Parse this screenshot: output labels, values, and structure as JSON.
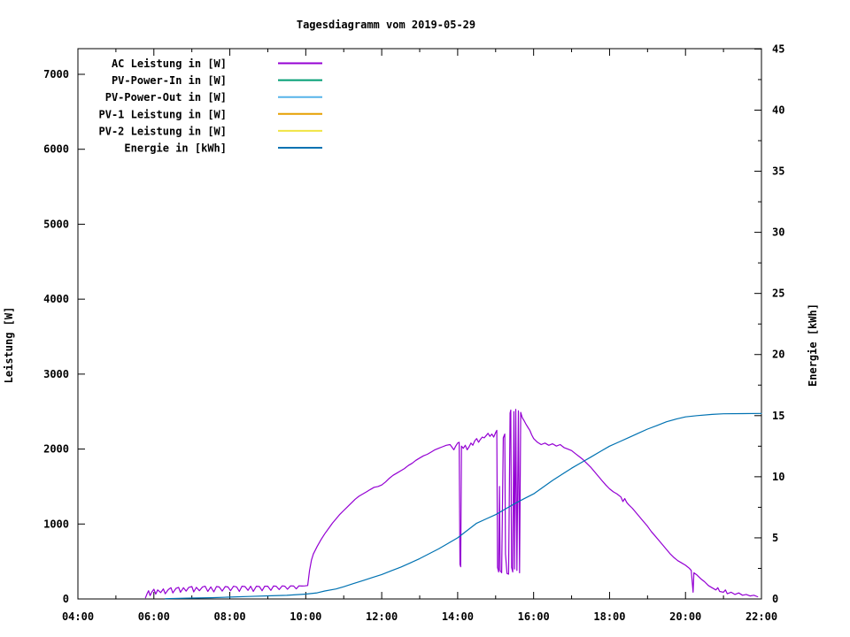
{
  "page": {
    "background": "#ffffff"
  },
  "chart_data": {
    "type": "line",
    "title": "Tagesdiagramm vom 2019-05-29",
    "grid": false,
    "legend_position": "top-left-inside",
    "x_axis": {
      "unit": "time-of-day",
      "start_hour": 4,
      "end_hour": 22,
      "major_tick_hours": 2,
      "minor_tick_hours": 1,
      "tick_labels": [
        "04:00",
        "06:00",
        "08:00",
        "10:00",
        "12:00",
        "14:00",
        "16:00",
        "18:00",
        "20:00",
        "22:00"
      ]
    },
    "y_axis": {
      "label": "Leistung [W]",
      "min": 0,
      "max": 7345,
      "tick_step": 1000,
      "tick_labels": [
        "0",
        "1000",
        "2000",
        "3000",
        "4000",
        "5000",
        "6000",
        "7000"
      ]
    },
    "y2_axis": {
      "label": "Energie [kWh]",
      "min": 0,
      "max": 45,
      "tick_step": 5,
      "minor_tick_step": 2.5,
      "tick_labels": [
        "0",
        "5",
        "10",
        "15",
        "20",
        "25",
        "30",
        "35",
        "40",
        "45"
      ]
    },
    "series": [
      {
        "name": "AC Leistung in [W]",
        "slug": "ac-leistung",
        "color": "#9400d3",
        "axis": "y1",
        "points": [
          [
            5.78,
            15
          ],
          [
            5.82,
            70
          ],
          [
            5.86,
            110
          ],
          [
            5.9,
            45
          ],
          [
            5.95,
            95
          ],
          [
            6.0,
            130
          ],
          [
            6.05,
            65
          ],
          [
            6.1,
            120
          ],
          [
            6.18,
            85
          ],
          [
            6.25,
            135
          ],
          [
            6.3,
            70
          ],
          [
            6.38,
            125
          ],
          [
            6.45,
            150
          ],
          [
            6.5,
            80
          ],
          [
            6.58,
            140
          ],
          [
            6.65,
            155
          ],
          [
            6.7,
            90
          ],
          [
            6.78,
            150
          ],
          [
            6.85,
            105
          ],
          [
            6.92,
            155
          ],
          [
            7.0,
            165
          ],
          [
            7.05,
            95
          ],
          [
            7.12,
            155
          ],
          [
            7.2,
            110
          ],
          [
            7.28,
            160
          ],
          [
            7.35,
            170
          ],
          [
            7.42,
            100
          ],
          [
            7.5,
            160
          ],
          [
            7.58,
            95
          ],
          [
            7.65,
            165
          ],
          [
            7.72,
            160
          ],
          [
            7.8,
            105
          ],
          [
            7.88,
            165
          ],
          [
            7.95,
            160
          ],
          [
            8.02,
            110
          ],
          [
            8.1,
            170
          ],
          [
            8.18,
            160
          ],
          [
            8.25,
            100
          ],
          [
            8.32,
            170
          ],
          [
            8.4,
            165
          ],
          [
            8.48,
            115
          ],
          [
            8.55,
            170
          ],
          [
            8.62,
            100
          ],
          [
            8.7,
            170
          ],
          [
            8.78,
            165
          ],
          [
            8.85,
            110
          ],
          [
            8.92,
            170
          ],
          [
            9.0,
            170
          ],
          [
            9.08,
            115
          ],
          [
            9.15,
            172
          ],
          [
            9.22,
            170
          ],
          [
            9.3,
            125
          ],
          [
            9.38,
            175
          ],
          [
            9.45,
            170
          ],
          [
            9.52,
            130
          ],
          [
            9.6,
            175
          ],
          [
            9.68,
            172
          ],
          [
            9.75,
            135
          ],
          [
            9.82,
            175
          ],
          [
            9.9,
            172
          ],
          [
            9.98,
            175
          ],
          [
            10.05,
            180
          ],
          [
            10.1,
            380
          ],
          [
            10.15,
            520
          ],
          [
            10.2,
            600
          ],
          [
            10.3,
            700
          ],
          [
            10.4,
            790
          ],
          [
            10.5,
            870
          ],
          [
            10.6,
            940
          ],
          [
            10.7,
            1010
          ],
          [
            10.8,
            1070
          ],
          [
            10.9,
            1130
          ],
          [
            11.0,
            1180
          ],
          [
            11.1,
            1230
          ],
          [
            11.2,
            1280
          ],
          [
            11.3,
            1330
          ],
          [
            11.4,
            1370
          ],
          [
            11.5,
            1400
          ],
          [
            11.6,
            1430
          ],
          [
            11.7,
            1460
          ],
          [
            11.8,
            1490
          ],
          [
            11.9,
            1500
          ],
          [
            12.0,
            1520
          ],
          [
            12.1,
            1560
          ],
          [
            12.2,
            1610
          ],
          [
            12.3,
            1650
          ],
          [
            12.4,
            1680
          ],
          [
            12.5,
            1710
          ],
          [
            12.6,
            1740
          ],
          [
            12.7,
            1780
          ],
          [
            12.8,
            1810
          ],
          [
            12.9,
            1850
          ],
          [
            13.0,
            1880
          ],
          [
            13.1,
            1910
          ],
          [
            13.2,
            1930
          ],
          [
            13.3,
            1960
          ],
          [
            13.4,
            1990
          ],
          [
            13.5,
            2010
          ],
          [
            13.6,
            2030
          ],
          [
            13.7,
            2050
          ],
          [
            13.8,
            2060
          ],
          [
            13.9,
            1990
          ],
          [
            13.95,
            2040
          ],
          [
            14.0,
            2080
          ],
          [
            14.04,
            2090
          ],
          [
            14.06,
            460
          ],
          [
            14.08,
            430
          ],
          [
            14.1,
            2040
          ],
          [
            14.15,
            2010
          ],
          [
            14.2,
            2050
          ],
          [
            14.25,
            1990
          ],
          [
            14.3,
            2030
          ],
          [
            14.35,
            2080
          ],
          [
            14.4,
            2050
          ],
          [
            14.45,
            2110
          ],
          [
            14.5,
            2140
          ],
          [
            14.55,
            2090
          ],
          [
            14.6,
            2130
          ],
          [
            14.65,
            2160
          ],
          [
            14.7,
            2150
          ],
          [
            14.75,
            2180
          ],
          [
            14.8,
            2210
          ],
          [
            14.85,
            2170
          ],
          [
            14.9,
            2200
          ],
          [
            14.95,
            2160
          ],
          [
            15.0,
            2220
          ],
          [
            15.03,
            2250
          ],
          [
            15.05,
            420
          ],
          [
            15.08,
            360
          ],
          [
            15.1,
            1500
          ],
          [
            15.12,
            380
          ],
          [
            15.16,
            350
          ],
          [
            15.2,
            2150
          ],
          [
            15.24,
            2200
          ],
          [
            15.26,
            600
          ],
          [
            15.3,
            340
          ],
          [
            15.34,
            330
          ],
          [
            15.38,
            2480
          ],
          [
            15.4,
            2520
          ],
          [
            15.42,
            420
          ],
          [
            15.45,
            360
          ],
          [
            15.48,
            2500
          ],
          [
            15.5,
            400
          ],
          [
            15.53,
            2530
          ],
          [
            15.56,
            380
          ],
          [
            15.6,
            2510
          ],
          [
            15.63,
            350
          ],
          [
            15.66,
            2490
          ],
          [
            15.7,
            2420
          ],
          [
            15.75,
            2380
          ],
          [
            15.8,
            2330
          ],
          [
            15.85,
            2290
          ],
          [
            15.9,
            2250
          ],
          [
            15.95,
            2190
          ],
          [
            16.0,
            2140
          ],
          [
            16.1,
            2090
          ],
          [
            16.2,
            2060
          ],
          [
            16.3,
            2080
          ],
          [
            16.4,
            2050
          ],
          [
            16.5,
            2070
          ],
          [
            16.6,
            2040
          ],
          [
            16.7,
            2060
          ],
          [
            16.8,
            2020
          ],
          [
            16.9,
            2000
          ],
          [
            17.0,
            1980
          ],
          [
            17.1,
            1940
          ],
          [
            17.2,
            1900
          ],
          [
            17.3,
            1860
          ],
          [
            17.4,
            1810
          ],
          [
            17.5,
            1760
          ],
          [
            17.6,
            1700
          ],
          [
            17.7,
            1640
          ],
          [
            17.8,
            1580
          ],
          [
            17.9,
            1520
          ],
          [
            18.0,
            1470
          ],
          [
            18.1,
            1430
          ],
          [
            18.2,
            1400
          ],
          [
            18.3,
            1360
          ],
          [
            18.35,
            1300
          ],
          [
            18.4,
            1340
          ],
          [
            18.45,
            1290
          ],
          [
            18.5,
            1260
          ],
          [
            18.6,
            1210
          ],
          [
            18.7,
            1150
          ],
          [
            18.8,
            1090
          ],
          [
            18.9,
            1030
          ],
          [
            19.0,
            970
          ],
          [
            19.1,
            900
          ],
          [
            19.2,
            840
          ],
          [
            19.3,
            780
          ],
          [
            19.4,
            720
          ],
          [
            19.5,
            660
          ],
          [
            19.6,
            600
          ],
          [
            19.7,
            550
          ],
          [
            19.8,
            510
          ],
          [
            19.9,
            480
          ],
          [
            20.0,
            450
          ],
          [
            20.05,
            430
          ],
          [
            20.1,
            410
          ],
          [
            20.15,
            380
          ],
          [
            20.2,
            90
          ],
          [
            20.22,
            350
          ],
          [
            20.3,
            320
          ],
          [
            20.4,
            270
          ],
          [
            20.5,
            230
          ],
          [
            20.6,
            180
          ],
          [
            20.7,
            150
          ],
          [
            20.8,
            120
          ],
          [
            20.85,
            150
          ],
          [
            20.9,
            100
          ],
          [
            21.0,
            90
          ],
          [
            21.05,
            120
          ],
          [
            21.1,
            70
          ],
          [
            21.2,
            90
          ],
          [
            21.3,
            60
          ],
          [
            21.4,
            80
          ],
          [
            21.5,
            50
          ],
          [
            21.6,
            60
          ],
          [
            21.7,
            40
          ],
          [
            21.8,
            50
          ],
          [
            21.9,
            30
          ]
        ]
      },
      {
        "name": "PV-Power-In in [W]",
        "slug": "pv-power-in",
        "color": "#009e73",
        "axis": "y1",
        "points": []
      },
      {
        "name": "PV-Power-Out in [W]",
        "slug": "pv-power-out",
        "color": "#56b4e9",
        "axis": "y1",
        "points": []
      },
      {
        "name": "PV-1 Leistung in [W]",
        "slug": "pv-1-leistung",
        "color": "#e69f00",
        "axis": "y1",
        "points": []
      },
      {
        "name": "PV-2 Leistung in [W]",
        "slug": "pv-2-leistung",
        "color": "#f0e442",
        "axis": "y1",
        "points": []
      },
      {
        "name": "Energie in [kWh]",
        "slug": "energie",
        "color": "#0072b2",
        "axis": "y2",
        "points": [
          [
            6.3,
            0.02
          ],
          [
            7.0,
            0.07
          ],
          [
            7.5,
            0.1
          ],
          [
            8.0,
            0.15
          ],
          [
            8.5,
            0.2
          ],
          [
            9.0,
            0.25
          ],
          [
            9.5,
            0.3
          ],
          [
            10.0,
            0.4
          ],
          [
            10.3,
            0.5
          ],
          [
            10.5,
            0.65
          ],
          [
            10.8,
            0.82
          ],
          [
            11.0,
            1.0
          ],
          [
            11.25,
            1.25
          ],
          [
            11.5,
            1.5
          ],
          [
            11.75,
            1.75
          ],
          [
            12.0,
            2.0
          ],
          [
            12.25,
            2.3
          ],
          [
            12.5,
            2.6
          ],
          [
            12.75,
            2.95
          ],
          [
            13.0,
            3.3
          ],
          [
            13.25,
            3.7
          ],
          [
            13.5,
            4.1
          ],
          [
            13.75,
            4.55
          ],
          [
            14.0,
            5.0
          ],
          [
            14.25,
            5.6
          ],
          [
            14.5,
            6.2
          ],
          [
            14.75,
            6.55
          ],
          [
            15.0,
            6.9
          ],
          [
            15.25,
            7.35
          ],
          [
            15.5,
            7.8
          ],
          [
            15.75,
            8.2
          ],
          [
            16.0,
            8.6
          ],
          [
            16.25,
            9.15
          ],
          [
            16.5,
            9.7
          ],
          [
            16.75,
            10.2
          ],
          [
            17.0,
            10.7
          ],
          [
            17.25,
            11.15
          ],
          [
            17.5,
            11.6
          ],
          [
            17.75,
            12.05
          ],
          [
            18.0,
            12.5
          ],
          [
            18.25,
            12.85
          ],
          [
            18.5,
            13.2
          ],
          [
            18.75,
            13.55
          ],
          [
            19.0,
            13.9
          ],
          [
            19.25,
            14.2
          ],
          [
            19.5,
            14.5
          ],
          [
            19.75,
            14.72
          ],
          [
            20.0,
            14.9
          ],
          [
            20.3,
            15.0
          ],
          [
            20.7,
            15.1
          ],
          [
            21.0,
            15.15
          ],
          [
            21.5,
            15.17
          ],
          [
            22.0,
            15.18
          ]
        ]
      }
    ]
  }
}
